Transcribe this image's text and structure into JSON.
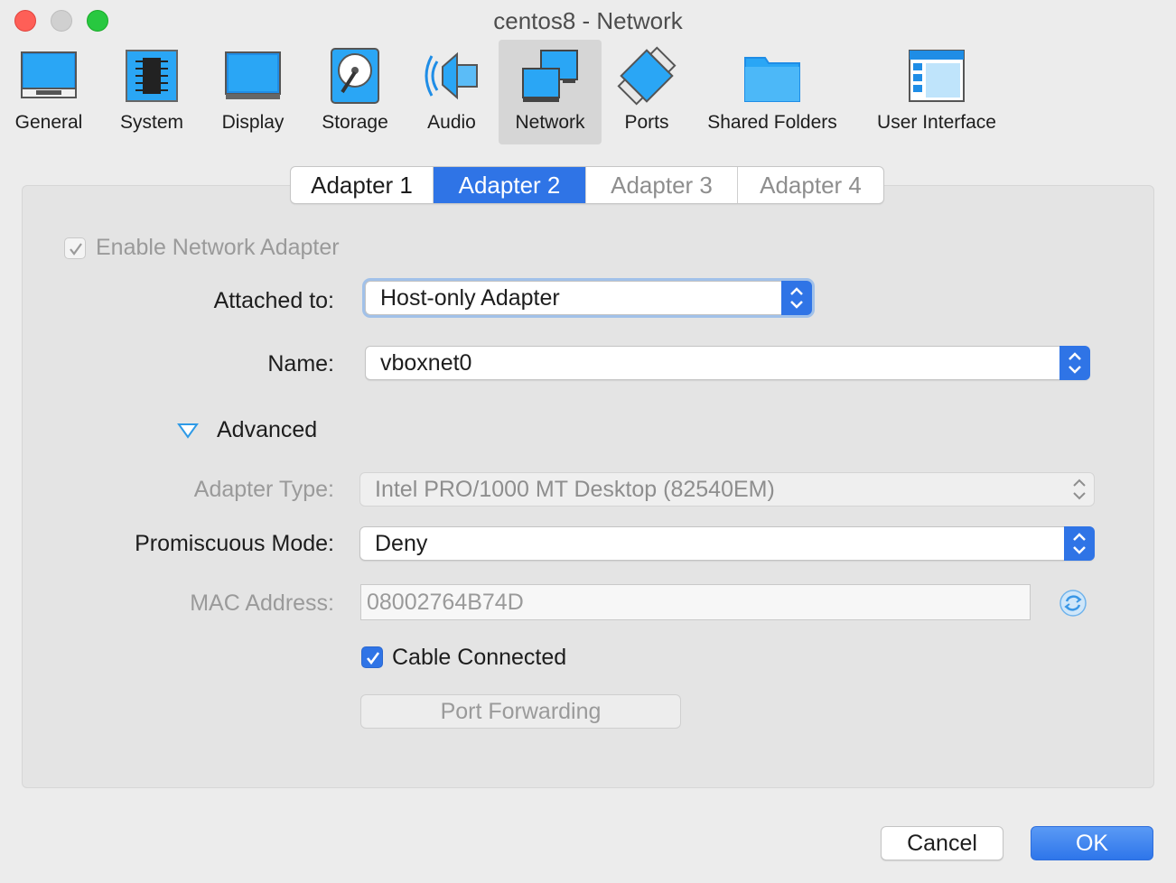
{
  "window": {
    "title": "centos8 - Network"
  },
  "toolbar": {
    "items": [
      {
        "label": "General",
        "icon": "general-icon"
      },
      {
        "label": "System",
        "icon": "chip-icon"
      },
      {
        "label": "Display",
        "icon": "monitor-icon"
      },
      {
        "label": "Storage",
        "icon": "hard-disk-icon"
      },
      {
        "label": "Audio",
        "icon": "speaker-icon"
      },
      {
        "label": "Network",
        "icon": "network-icon",
        "active": true
      },
      {
        "label": "Ports",
        "icon": "ports-icon"
      },
      {
        "label": "Shared Folders",
        "icon": "folder-icon"
      },
      {
        "label": "User Interface",
        "icon": "user-interface-icon"
      }
    ]
  },
  "tabs": [
    "Adapter 1",
    "Adapter 2",
    "Adapter 3",
    "Adapter 4"
  ],
  "selected_tab": "Adapter 2",
  "form": {
    "enable_adapter_label": "Enable Network Adapter",
    "attached_to_label": "Attached to:",
    "attached_to_value": "Host-only Adapter",
    "name_label": "Name:",
    "name_value": "vboxnet0",
    "advanced_label": "Advanced",
    "adapter_type_label": "Adapter Type:",
    "adapter_type_value": "Intel PRO/1000 MT Desktop (82540EM)",
    "promiscuous_label": "Promiscuous Mode:",
    "promiscuous_value": "Deny",
    "mac_label": "MAC Address:",
    "mac_value": "08002764B74D",
    "cable_label": "Cable Connected",
    "port_forwarding_label": "Port Forwarding"
  },
  "buttons": {
    "cancel": "Cancel",
    "ok": "OK"
  },
  "colors": {
    "accent": "#2f74e6",
    "window_bg": "#ececec",
    "panel_bg": "#e4e4e4"
  }
}
